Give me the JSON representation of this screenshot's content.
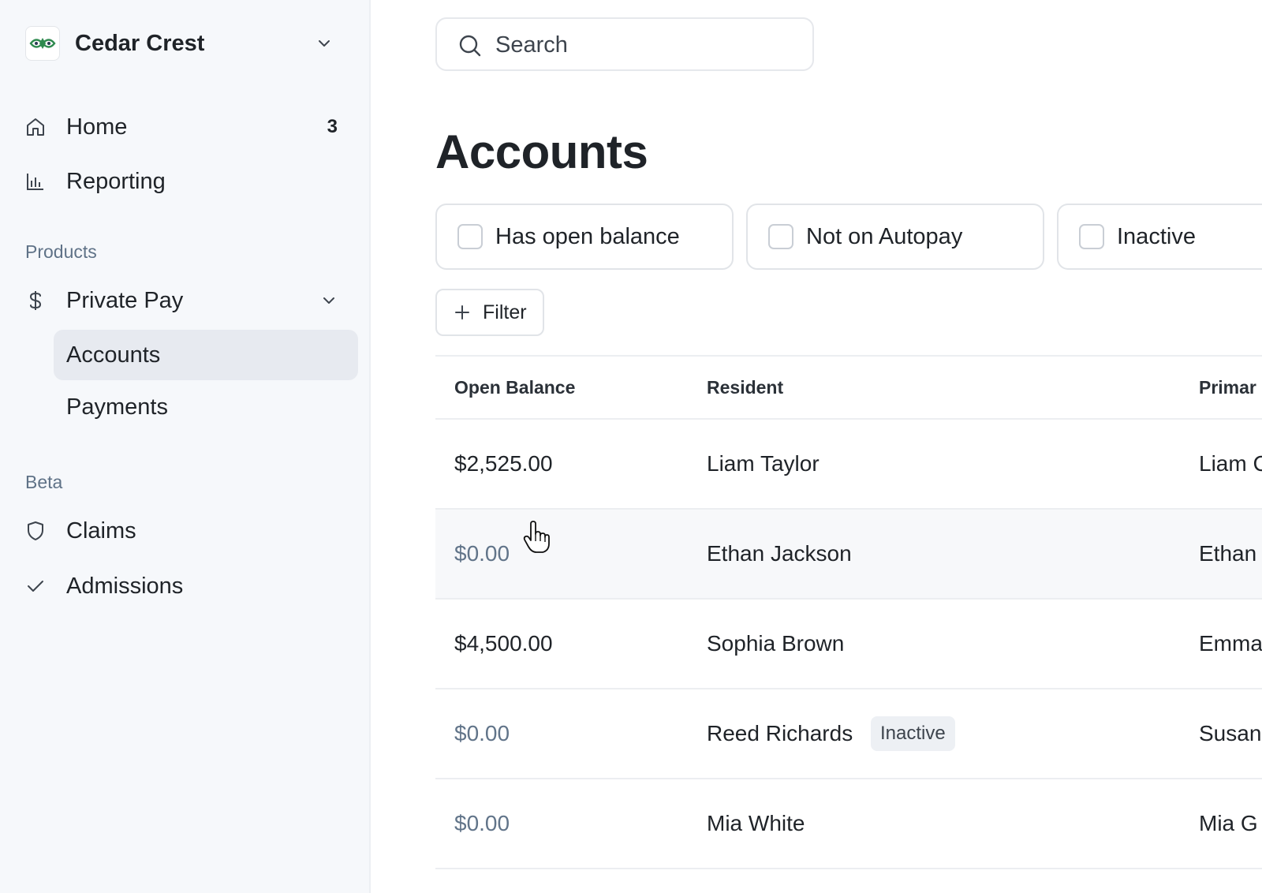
{
  "sidebar": {
    "org_name": "Cedar Crest",
    "nav": [
      {
        "label": "Home",
        "icon": "home-icon",
        "badge": "3"
      },
      {
        "label": "Reporting",
        "icon": "bar-chart-icon"
      }
    ],
    "sections": {
      "products": "Products",
      "beta": "Beta"
    },
    "products": {
      "label": "Private Pay",
      "icon": "dollar-icon",
      "children": [
        {
          "label": "Accounts",
          "active": true
        },
        {
          "label": "Payments",
          "active": false
        }
      ]
    },
    "beta_items": [
      {
        "label": "Claims",
        "icon": "shield-icon"
      },
      {
        "label": "Admissions",
        "icon": "check-icon"
      }
    ]
  },
  "search": {
    "placeholder": "Search"
  },
  "page": {
    "title": "Accounts"
  },
  "quick_filters": [
    {
      "label": "Has open balance",
      "checked": false
    },
    {
      "label": "Not on Autopay",
      "checked": false
    },
    {
      "label": "Inactive",
      "checked": false
    }
  ],
  "filter_button": {
    "label": "Filter"
  },
  "table": {
    "columns": [
      "Open Balance",
      "Resident",
      "Primar"
    ],
    "rows": [
      {
        "open_balance": "$2,525.00",
        "resident": "Liam Taylor",
        "primary": "Liam C",
        "badge": null
      },
      {
        "open_balance": "$0.00",
        "resident": "Ethan Jackson",
        "primary": "Ethan",
        "badge": null
      },
      {
        "open_balance": "$4,500.00",
        "resident": "Sophia Brown",
        "primary": "Emma",
        "badge": null
      },
      {
        "open_balance": "$0.00",
        "resident": "Reed Richards",
        "primary": "Susan",
        "badge": "Inactive"
      },
      {
        "open_balance": "$0.00",
        "resident": "Mia White",
        "primary": "Mia G",
        "badge": null
      }
    ]
  },
  "colors": {
    "sidebar_bg": "#f6f8fb",
    "active_item_bg": "#e7eaf0",
    "muted_text": "#617489",
    "logo_green": "#2f8a4f"
  }
}
